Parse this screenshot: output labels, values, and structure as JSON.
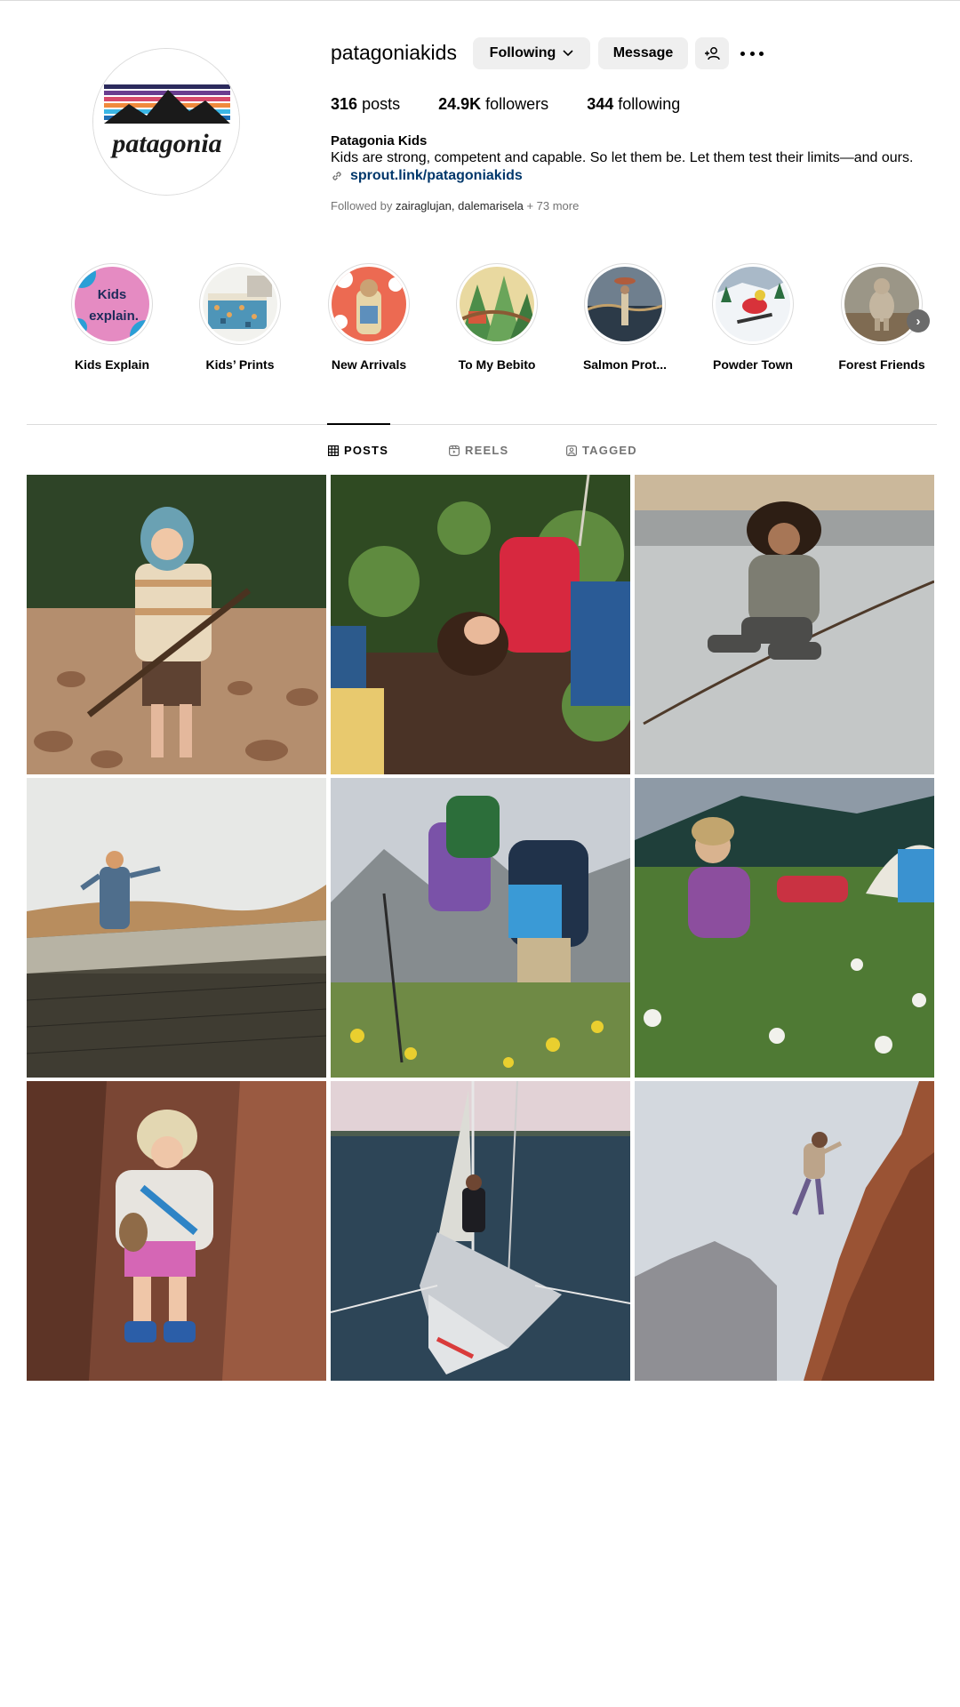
{
  "profile": {
    "username": "patagoniakids",
    "following_label": "Following",
    "message_label": "Message",
    "logo_text": "patagonia",
    "stats": [
      {
        "count": "316",
        "label": "posts"
      },
      {
        "count": "24.9K",
        "label": "followers"
      },
      {
        "count": "344",
        "label": "following"
      }
    ],
    "bio_name": "Patagonia Kids",
    "bio_text": "Kids are strong, competent and capable. So let them be. Let them test their limits—and ours.",
    "link": "sprout.link/patagoniakids",
    "followed_by_prefix": "Followed by",
    "followed_user_1": "zairaglujan",
    "followed_sep": ",",
    "followed_user_2": "dalemarisela",
    "followed_more": "+ 73 more"
  },
  "highlights": [
    {
      "label": "Kids Explain",
      "cover_text_1": "Kids",
      "cover_text_2": "explain."
    },
    {
      "label": "Kids’ Prints"
    },
    {
      "label": "New Arrivals"
    },
    {
      "label": "To My Bebito"
    },
    {
      "label": "Salmon Prot..."
    },
    {
      "label": "Powder Town"
    },
    {
      "label": "Forest Friends"
    }
  ],
  "tabs": [
    {
      "label": "POSTS",
      "active": true
    },
    {
      "label": "REELS",
      "active": false
    },
    {
      "label": "TAGGED",
      "active": false
    }
  ],
  "colors": {
    "button_bg": "#efefef",
    "link": "#00376b",
    "muted": "#737373",
    "border": "#dbdbdb"
  },
  "icons": [
    "chevron-down-icon",
    "add-person-icon",
    "more-icon",
    "link-icon",
    "grid-icon",
    "reels-icon",
    "tagged-icon",
    "chevron-right-icon"
  ]
}
